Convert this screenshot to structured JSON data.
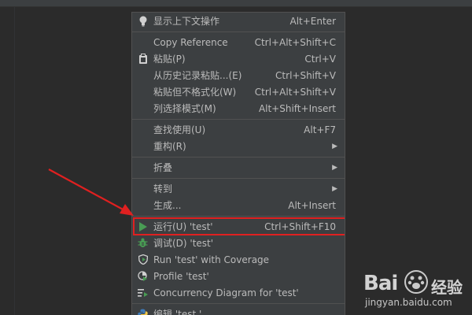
{
  "menu": {
    "items": [
      {
        "label": "显示上下文操作",
        "shortcut": "Alt+Enter",
        "icon": "lightbulb-icon"
      },
      {
        "label": "Copy Reference",
        "shortcut": "Ctrl+Alt+Shift+C",
        "icon": ""
      },
      {
        "label": "粘贴(P)",
        "shortcut": "Ctrl+V",
        "icon": "clipboard-icon"
      },
      {
        "label": "从历史记录粘贴...(E)",
        "shortcut": "Ctrl+Shift+V",
        "icon": ""
      },
      {
        "label": "粘贴但不格式化(W)",
        "shortcut": "Ctrl+Alt+Shift+V",
        "icon": ""
      },
      {
        "label": "列选择模式(M)",
        "shortcut": "Alt+Shift+Insert",
        "icon": ""
      },
      {
        "label": "查找使用(U)",
        "shortcut": "Alt+F7",
        "icon": ""
      },
      {
        "label": "重构(R)",
        "shortcut": "",
        "icon": ""
      },
      {
        "label": "折叠",
        "shortcut": "",
        "icon": ""
      },
      {
        "label": "转到",
        "shortcut": "",
        "icon": ""
      },
      {
        "label": "生成...",
        "shortcut": "Alt+Insert",
        "icon": ""
      },
      {
        "label": "运行(U) 'test'",
        "shortcut": "Ctrl+Shift+F10",
        "icon": "run-icon"
      },
      {
        "label": "调试(D) 'test'",
        "shortcut": "",
        "icon": "debug-bug-icon"
      },
      {
        "label": "Run 'test' with Coverage",
        "shortcut": "",
        "icon": "coverage-shield-icon"
      },
      {
        "label": "Profile 'test'",
        "shortcut": "",
        "icon": "profile-icon"
      },
      {
        "label": "Concurrency Diagram for 'test'",
        "shortcut": "",
        "icon": "concurrency-diagram-icon"
      },
      {
        "label": "编辑 'test '...",
        "shortcut": "",
        "icon": "python-icon"
      }
    ]
  },
  "colors": {
    "background": "#2b2b2b",
    "menu_bg": "#3c3f41",
    "run_green": "#499c54",
    "highlight_red": "#e02020"
  },
  "watermark": {
    "logo": "Bai",
    "brand": "经验",
    "url": "jingyan.baidu.com"
  }
}
